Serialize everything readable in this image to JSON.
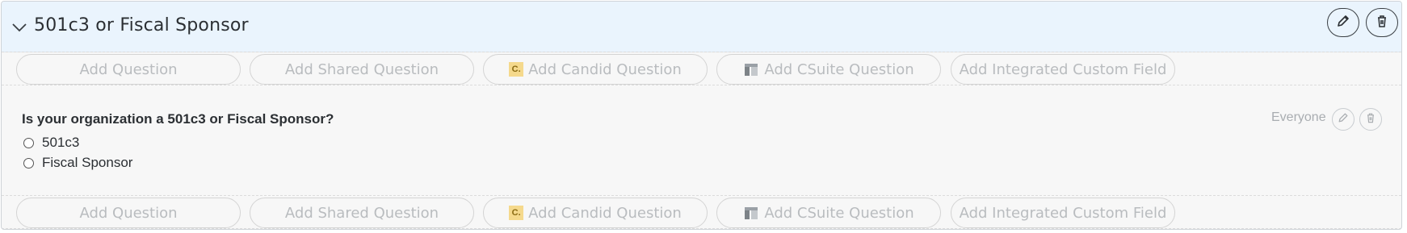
{
  "section": {
    "title": "501c3 or Fiscal Sponsor"
  },
  "add_buttons": {
    "add_question": "Add Question",
    "add_shared_question": "Add Shared Question",
    "add_candid_question": "Add Candid Question",
    "candid_icon_text": "C.",
    "add_csuite_question": "Add CSuite Question",
    "add_integrated_custom_field": "Add Integrated Custom Field"
  },
  "question": {
    "text": "Is your organization a 501c3 or Fiscal Sponsor?",
    "options": [
      "501c3",
      "Fiscal Sponsor"
    ],
    "audience": "Everyone"
  },
  "icons": {
    "collapse": "chevron-down-icon",
    "edit": "pencil-icon",
    "delete": "trash-icon",
    "candid": "candid-logo-icon",
    "csuite": "csuite-logo-icon"
  }
}
